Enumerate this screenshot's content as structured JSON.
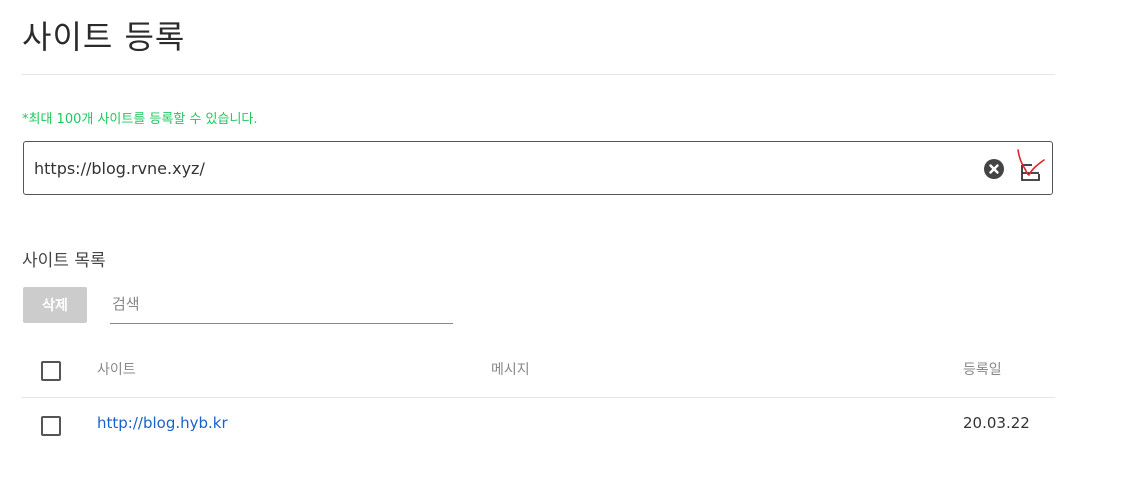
{
  "page": {
    "title": "사이트 등록",
    "notice": "*최대 100개 사이트를 등록할 수 있습니다."
  },
  "url_input": {
    "value": "https://blog.rvne.xyz/"
  },
  "site_list": {
    "title": "사이트 목록",
    "delete_label": "삭제",
    "search_placeholder": "검색",
    "columns": {
      "site": "사이트",
      "message": "메시지",
      "date": "등록일"
    },
    "rows": [
      {
        "site": "http://blog.hyb.kr",
        "message": "",
        "date": "20.03.22"
      }
    ]
  },
  "colors": {
    "notice_green": "#1ec85f",
    "link_blue": "#1a62c7",
    "disabled_button": "#cccccc",
    "annotation_red": "#e0242c"
  },
  "icons": {
    "clear": "clear-circle-icon",
    "submit": "submit-tray-icon",
    "annotation": "red-check-mark"
  }
}
